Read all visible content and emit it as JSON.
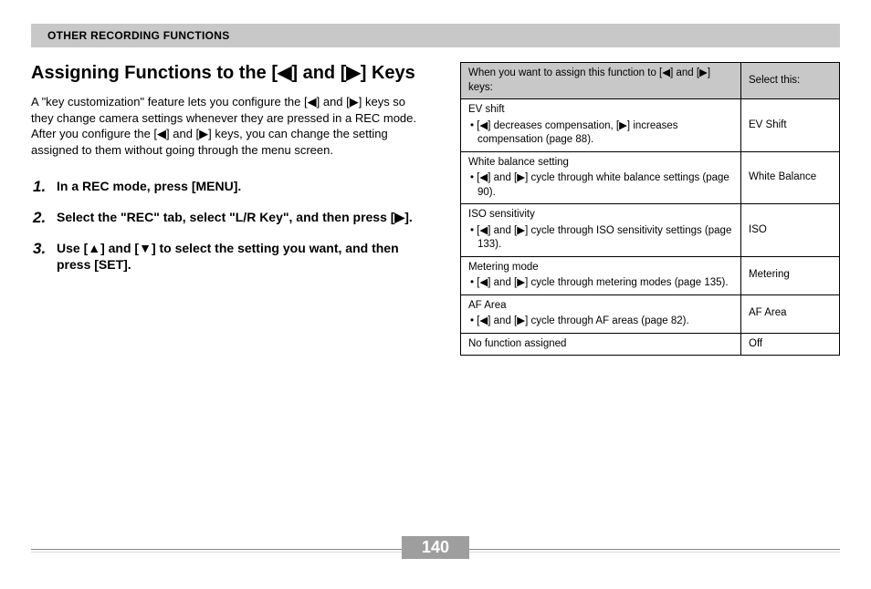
{
  "section_header": "OTHER RECORDING FUNCTIONS",
  "heading": "Assigning Functions to the [◀] and [▶] Keys",
  "intro": "A \"key customization\" feature lets you configure the [◀] and [▶] keys so they change camera settings whenever they are pressed in a REC mode. After you configure the [◀] and [▶] keys, you can change the setting assigned to them without going through the menu screen.",
  "steps": [
    {
      "num": "1.",
      "text": "In a REC mode, press [MENU]."
    },
    {
      "num": "2.",
      "text": "Select the \"REC\" tab, select \"L/R Key\", and then press [▶]."
    },
    {
      "num": "3.",
      "text": "Use [▲] and [▼] to select the setting you want, and then press [SET]."
    }
  ],
  "table": {
    "head_left": "When you want to assign this function to [◀] and [▶] keys:",
    "head_right": "Select this:",
    "rows": [
      {
        "title": "EV shift",
        "bullet": "• [◀] decreases compensation, [▶] increases compensation (page 88).",
        "select": "EV Shift"
      },
      {
        "title": "White balance setting",
        "bullet": "• [◀] and [▶] cycle through white balance settings (page 90).",
        "select": "White Balance"
      },
      {
        "title": "ISO sensitivity",
        "bullet": "• [◀] and [▶] cycle through ISO sensitivity settings (page 133).",
        "select": "ISO"
      },
      {
        "title": "Metering mode",
        "bullet": "• [◀] and [▶] cycle through metering modes (page 135).",
        "select": "Metering"
      },
      {
        "title": "AF Area",
        "bullet": "• [◀] and [▶] cycle through AF areas (page 82).",
        "select": "AF Area"
      },
      {
        "title": "No function assigned",
        "bullet": "",
        "select": "Off"
      }
    ]
  },
  "page_number": "140"
}
